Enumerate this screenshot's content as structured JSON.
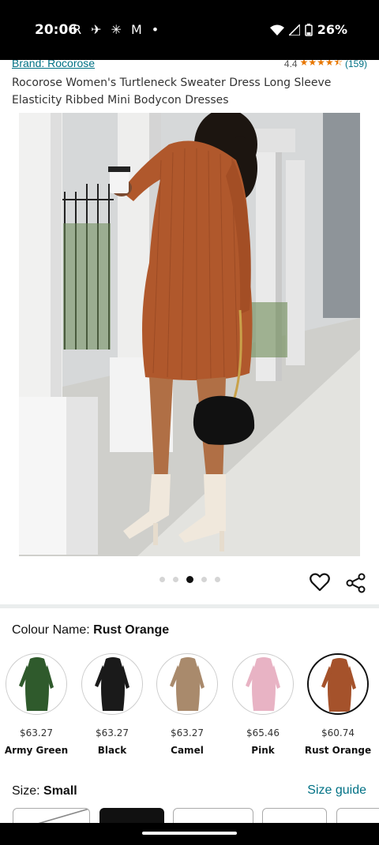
{
  "status_bar": {
    "time": "20:06",
    "battery": "26%",
    "notification_icons": [
      "R",
      "✈",
      "✳",
      "M",
      "•"
    ]
  },
  "product": {
    "brand": "Brand: Rocorose",
    "rating_value": "4.4",
    "rating_stars": 4.4,
    "rating_count": "(159)",
    "title": "Rocorose Women's Turtleneck Sweater Dress Long Sleeve Elasticity Ribbed Mini Bodycon Dresses"
  },
  "gallery": {
    "dot_count": 5,
    "active_index": 2
  },
  "colour": {
    "label": "Colour Name:",
    "selected": "Rust Orange",
    "options": [
      {
        "price": "$63.27",
        "name": "Army Green",
        "color": "#2f5a2c"
      },
      {
        "price": "$63.27",
        "name": "Black",
        "color": "#1a1a1a"
      },
      {
        "price": "$63.27",
        "name": "Camel",
        "color": "#a98a6c"
      },
      {
        "price": "$65.46",
        "name": "Pink",
        "color": "#e8b3c4"
      },
      {
        "price": "$60.74",
        "name": "Rust Orange",
        "color": "#a5522b"
      }
    ]
  },
  "size": {
    "label": "Size:",
    "selected": "Small",
    "guide_label": "Size guide"
  }
}
